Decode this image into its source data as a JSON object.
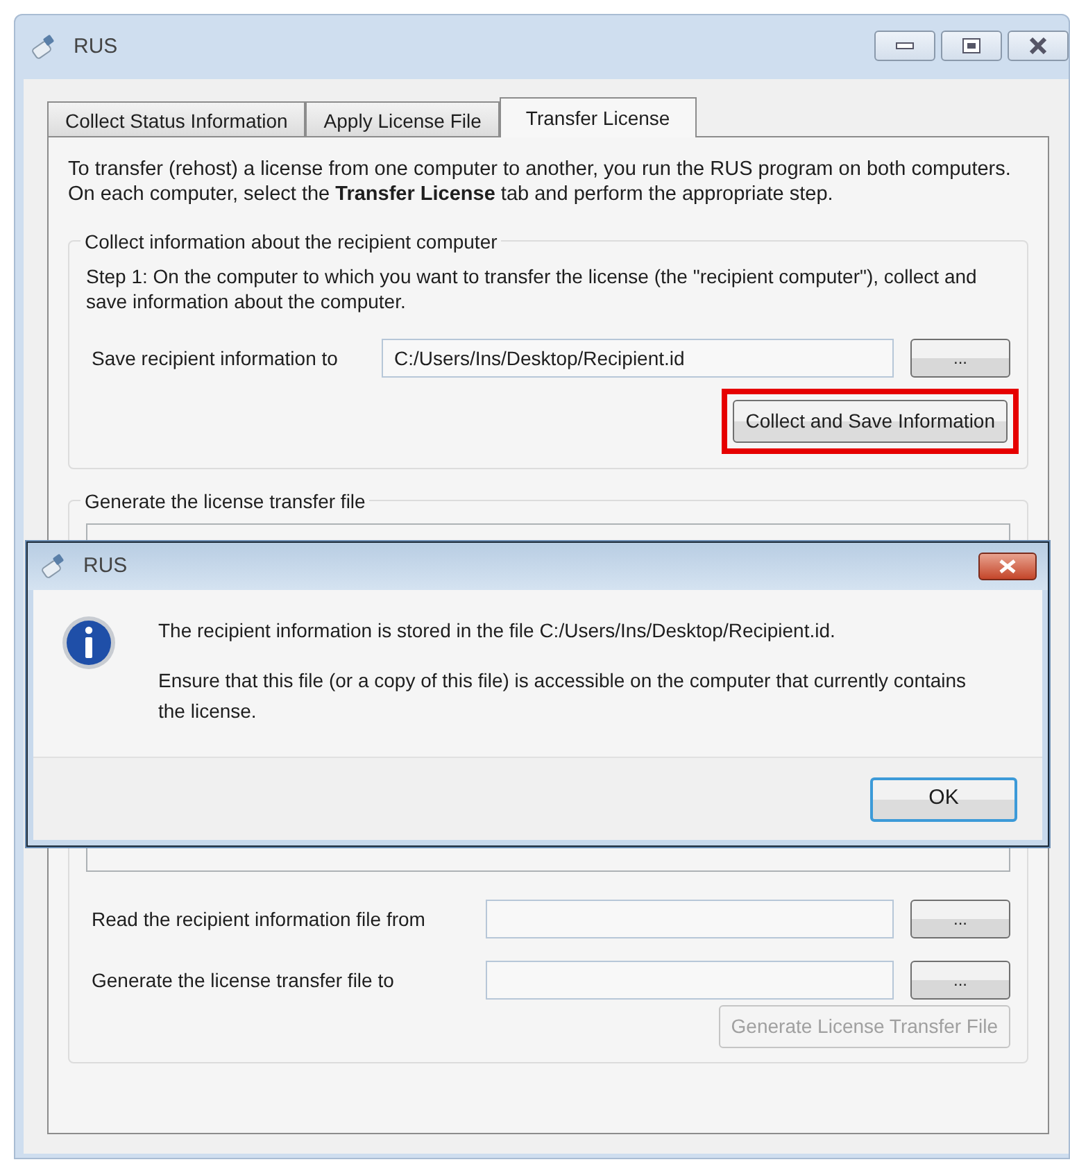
{
  "window": {
    "title": "RUS"
  },
  "tabs": [
    {
      "label": "Collect Status Information",
      "selected": false
    },
    {
      "label": "Apply License File",
      "selected": false
    },
    {
      "label": "Transfer License",
      "selected": true
    }
  ],
  "intro": "To transfer (rehost) a license from one computer to another, you run the RUS program on both computers. On each computer, select the **Transfer License** tab and perform the appropriate step.",
  "groups": [
    {
      "legend": "Collect information about the recipient computer",
      "step": "Step 1: On the computer to which you want to transfer the license (the \"recipient computer\"), collect and save information about the computer.",
      "has_text_area": false,
      "fields": [
        {
          "label": "Save recipient information to",
          "value": "C:/Users/Ins/Desktop/Recipient.id",
          "browse": "..."
        }
      ],
      "action": {
        "label": "Collect and Save Information",
        "disabled": false,
        "highlighted": true
      }
    },
    {
      "legend": "Generate the license transfer file",
      "has_text_area": true,
      "fields": [
        {
          "label": "Read the recipient information file from",
          "browse": "..."
        },
        {
          "label": "Generate the license transfer file to",
          "browse": "..."
        }
      ],
      "action": {
        "label": "Generate License Transfer File",
        "disabled": true,
        "highlighted": false
      }
    }
  ],
  "dialog": {
    "title": "RUS",
    "kind": "info",
    "messages": [
      "The recipient information is stored in the file C:/Users/Ins/Desktop/Recipient.id.",
      "Ensure that this file (or a copy of this file) is accessible on the computer that currently contains the license."
    ],
    "button": "OK"
  }
}
